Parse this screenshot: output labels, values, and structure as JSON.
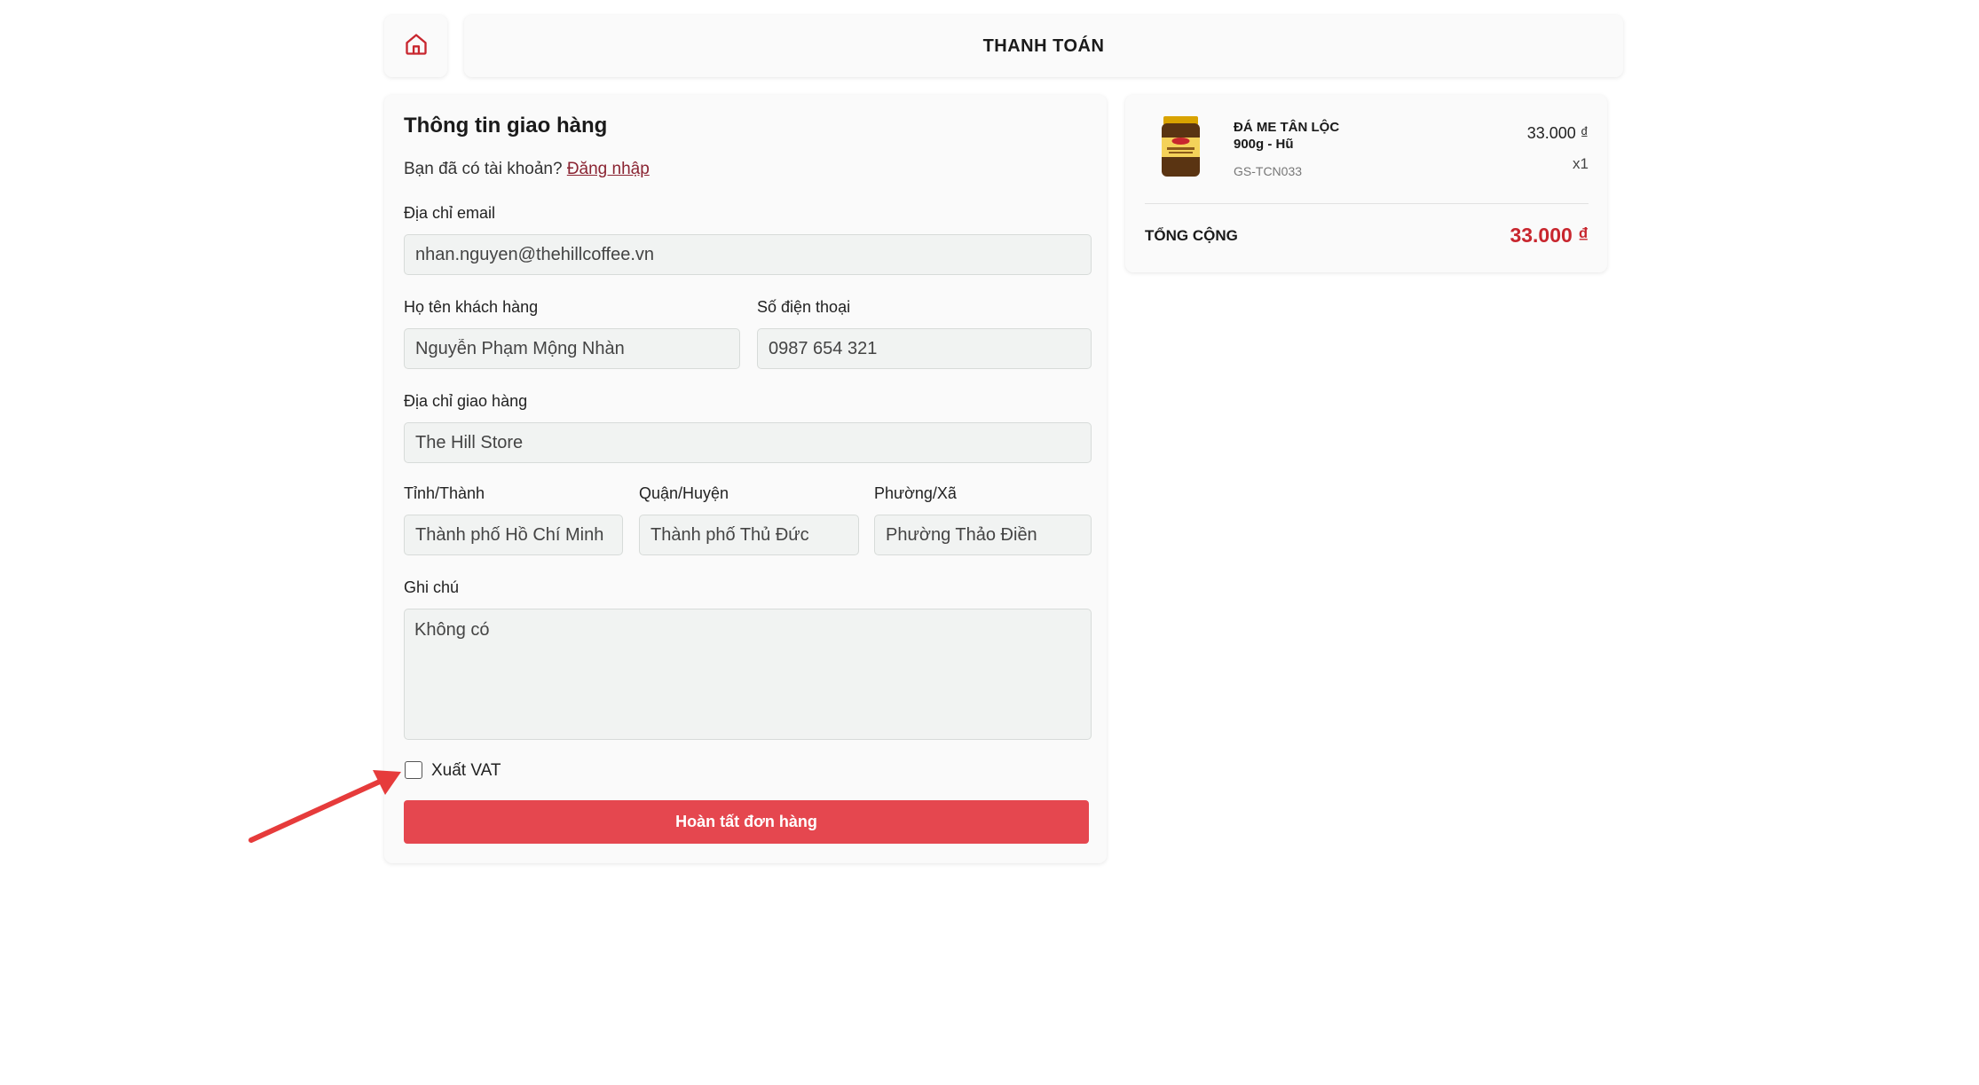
{
  "header": {
    "home_icon": "home-icon",
    "title": "THANH TOÁN"
  },
  "form": {
    "section_title": "Thông tin giao hàng",
    "login_prompt": "Bạn đã có tài khoản?",
    "login_link": "Đăng nhập",
    "email": {
      "label": "Địa chỉ email",
      "value": "nhan.nguyen@thehillcoffee.vn"
    },
    "full_name": {
      "label": "Họ tên khách hàng",
      "value": "Nguyễn Phạm Mộng Nhàn"
    },
    "phone": {
      "label": "Số điện thoại",
      "value": "0987 654 321"
    },
    "address": {
      "label": "Địa chỉ giao hàng",
      "value": "The Hill Store"
    },
    "province": {
      "label": "Tỉnh/Thành",
      "value": "Thành phố Hồ Chí Minh"
    },
    "district": {
      "label": "Quận/Huyện",
      "value": "Thành phố Thủ Đức"
    },
    "ward": {
      "label": "Phường/Xã",
      "value": "Phường Thảo Điền"
    },
    "note": {
      "label": "Ghi chú",
      "value": "Không có"
    },
    "vat": {
      "label": "Xuất VAT",
      "checked": false
    },
    "submit_label": "Hoàn tất đơn hàng"
  },
  "summary": {
    "items": [
      {
        "name": "ĐÁ ME TÂN LỘC 900g - Hũ",
        "sku": "GS-TCN033",
        "price": "33.000 ₫",
        "qty": "x1",
        "image_icon": "product-jar-image"
      }
    ],
    "total_label": "TỔNG CỘNG",
    "total_value": "33.000 ₫"
  },
  "colors": {
    "accent": "#e5474f",
    "total": "#c8262e",
    "link": "#8a2432",
    "annotation_arrow": "#e63b3b"
  }
}
